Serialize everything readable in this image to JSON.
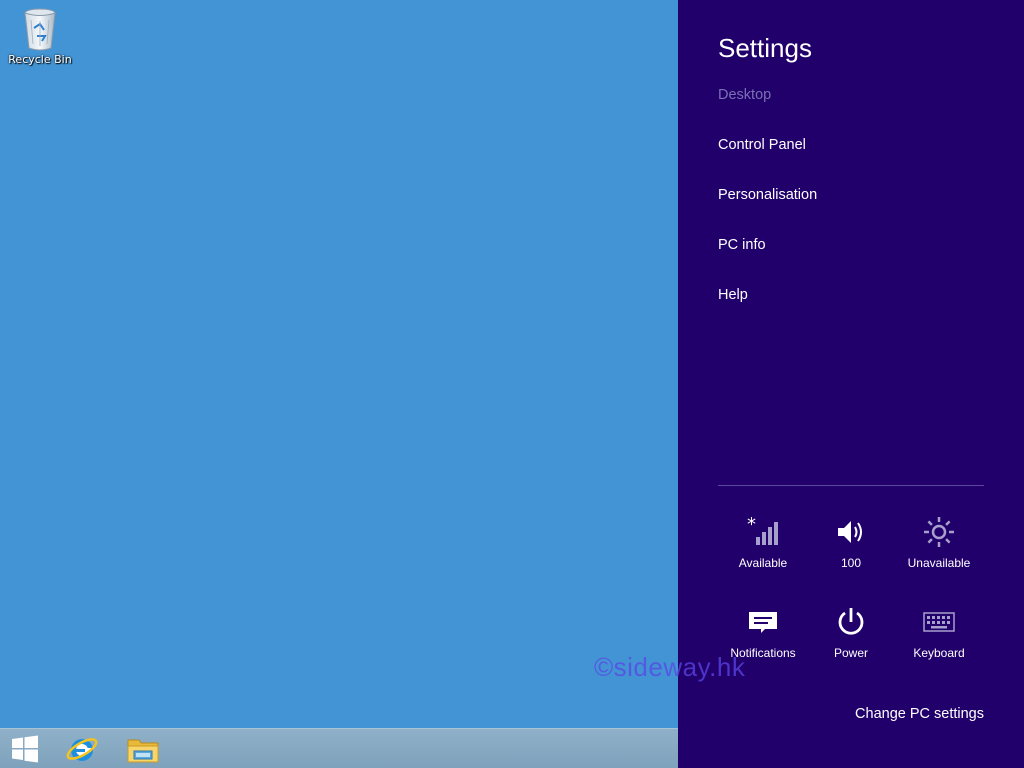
{
  "desktop": {
    "icons": [
      {
        "label": "Recycle Bin",
        "icon": "recycle-bin-icon"
      }
    ],
    "background_color": "#4394d4"
  },
  "taskbar": {
    "items": [
      {
        "icon": "windows-start-icon"
      },
      {
        "icon": "internet-explorer-icon"
      },
      {
        "icon": "file-explorer-icon"
      }
    ]
  },
  "settings_charm": {
    "title": "Settings",
    "context": "Desktop",
    "items": [
      {
        "label": "Control Panel"
      },
      {
        "label": "Personalisation"
      },
      {
        "label": "PC info"
      },
      {
        "label": "Help"
      }
    ],
    "quick_tiles": [
      {
        "label": "Available",
        "icon": "network-icon"
      },
      {
        "label": "100",
        "icon": "volume-icon"
      },
      {
        "label": "Unavailable",
        "icon": "brightness-icon"
      },
      {
        "label": "Notifications",
        "icon": "notifications-icon"
      },
      {
        "label": "Power",
        "icon": "power-icon"
      },
      {
        "label": "Keyboard",
        "icon": "keyboard-icon"
      }
    ],
    "change_pc_settings": "Change PC settings",
    "background_color": "#21006b"
  },
  "watermark": "©sideway.hk"
}
